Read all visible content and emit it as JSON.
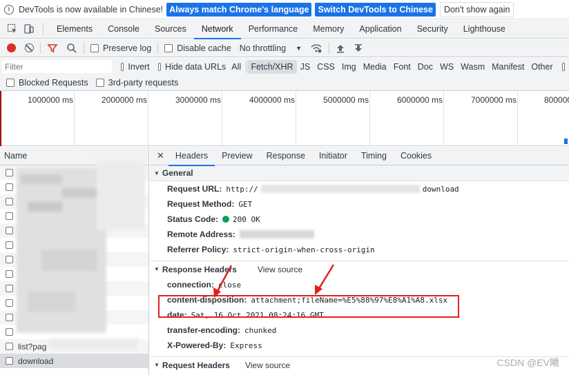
{
  "infobar": {
    "message": "DevTools is now available in Chinese!",
    "match_language": "Always match Chrome's language",
    "switch_chinese": "Switch DevTools to Chinese",
    "dont_show": "Don't show again"
  },
  "tabs": [
    "Elements",
    "Console",
    "Sources",
    "Network",
    "Performance",
    "Memory",
    "Application",
    "Security",
    "Lighthouse"
  ],
  "active_tab": "Network",
  "toolbar": {
    "preserve_log": "Preserve log",
    "disable_cache": "Disable cache",
    "throttling": "No throttling"
  },
  "filter": {
    "placeholder": "Filter",
    "invert": "Invert",
    "hide_data_urls": "Hide data URLs",
    "types": [
      "All",
      "Fetch/XHR",
      "JS",
      "CSS",
      "Img",
      "Media",
      "Font",
      "Doc",
      "WS",
      "Wasm",
      "Manifest",
      "Other"
    ],
    "active_type": "Fetch/XHR",
    "blocked_requests": "Blocked Requests",
    "third_party": "3rd-party requests"
  },
  "timeline": {
    "labels": [
      "1000000 ms",
      "2000000 ms",
      "3000000 ms",
      "4000000 ms",
      "5000000 ms",
      "6000000 ms",
      "7000000 ms",
      "800000"
    ]
  },
  "requests": {
    "header": "Name",
    "rows": [
      "",
      "",
      "",
      "",
      "",
      "",
      "",
      "",
      "",
      "",
      "",
      "",
      "list?pag",
      "download"
    ]
  },
  "detail_tabs": [
    "Headers",
    "Preview",
    "Response",
    "Initiator",
    "Timing",
    "Cookies"
  ],
  "general": {
    "title": "General",
    "request_url_key": "Request URL:",
    "request_url_val": "http://",
    "request_url_tail": "download",
    "method_key": "Request Method:",
    "method_val": "GET",
    "status_key": "Status Code:",
    "status_val": "200 OK",
    "remote_key": "Remote Address:",
    "referrer_key": "Referrer Policy:",
    "referrer_val": "strict-origin-when-cross-origin"
  },
  "response_headers": {
    "title": "Response Headers",
    "view_source": "View source",
    "connection_key": "connection:",
    "connection_val": "close",
    "cd_key": "content-disposition:",
    "cd_val": "attachment;fileName=%E5%88%97%E8%A1%A8.xlsx",
    "date_key": "date:",
    "date_val": "Sat, 16 Oct 2021 08:24:16 GMT",
    "te_key": "transfer-encoding:",
    "te_val": "chunked",
    "xpb_key": "X-Powered-By:",
    "xpb_val": "Express"
  },
  "request_headers": {
    "title": "Request Headers",
    "view_source": "View source"
  },
  "watermark": "CSDN @EV曦",
  "colors": {
    "accent": "#1a73e8",
    "record": "#d93025",
    "highlight": "#e02020",
    "status_ok": "#0f9d58"
  }
}
